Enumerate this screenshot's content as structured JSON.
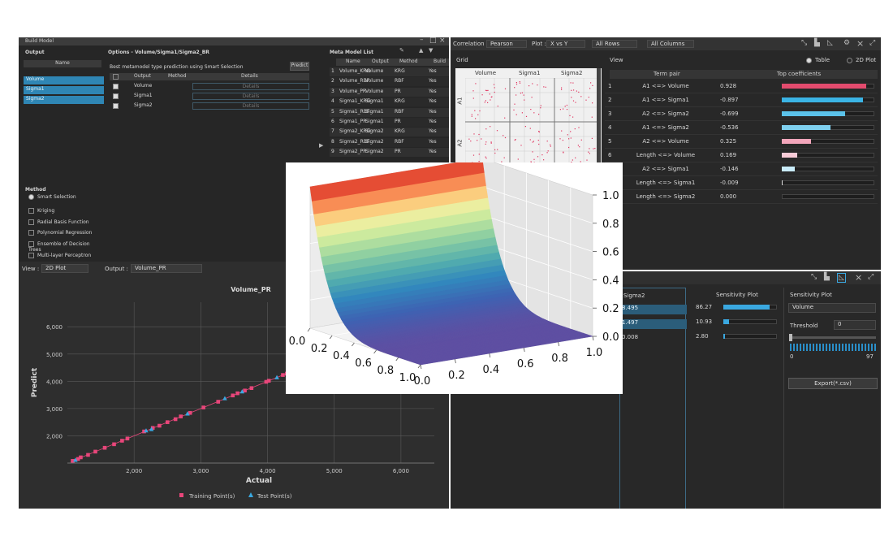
{
  "model_window": {
    "title": "Build Model",
    "output_panel": {
      "header": "Output",
      "col_name": "Name",
      "items": [
        "Volume",
        "Sigma1",
        "Sigma2"
      ]
    },
    "options_panel": {
      "header": "Options - Volume/Sigma1/Sigma2_BR",
      "hint": "Best metamodel type prediction using Smart Selection",
      "predict_label": "Predict",
      "cols": [
        "Output",
        "Method",
        "Details"
      ],
      "rows": [
        {
          "output": "Volume",
          "method": "",
          "details": "Details"
        },
        {
          "output": "Sigma1",
          "method": "",
          "details": "Details"
        },
        {
          "output": "Sigma2",
          "method": "",
          "details": "Details"
        }
      ]
    },
    "method_panel": {
      "header": "Method",
      "options": [
        "Smart Selection",
        "Kriging",
        "Radial Basis Function",
        "Polynomial Regression",
        "Ensemble of Decision Trees",
        "Multi-layer Perceptron"
      ]
    },
    "meta_list": {
      "header": "Meta Model List",
      "cols": [
        "Name",
        "Output",
        "Method",
        "Build"
      ],
      "rows": [
        [
          "1",
          "Volume_KRG",
          "Volume",
          "KRG",
          "Yes"
        ],
        [
          "2",
          "Volume_RBF",
          "Volume",
          "RBF",
          "Yes"
        ],
        [
          "3",
          "Volume_PR",
          "Volume",
          "PR",
          "Yes"
        ],
        [
          "4",
          "Sigma1_KRG",
          "Sigma1",
          "KRG",
          "Yes"
        ],
        [
          "5",
          "Sigma1_RBF",
          "Sigma1",
          "RBF",
          "Yes"
        ],
        [
          "6",
          "Sigma1_PR",
          "Sigma1",
          "PR",
          "Yes"
        ],
        [
          "7",
          "Sigma2_KRG",
          "Sigma2",
          "KRG",
          "Yes"
        ],
        [
          "8",
          "Sigma2_RBF",
          "Sigma2",
          "RBF",
          "Yes"
        ],
        [
          "9",
          "Sigma2_PR",
          "Sigma2",
          "PR",
          "Yes"
        ]
      ]
    }
  },
  "correlation_window": {
    "toolbar": {
      "correlation_label": "Correlation :",
      "correlation_value": "Pearson",
      "plot_label": "Plot :",
      "plot_value": "X vs Y",
      "rows_value": "All Rows",
      "columns_value": "All Columns"
    },
    "grid_label": "Grid",
    "grid_cols": [
      "Volume",
      "Sigma1",
      "Sigma2"
    ],
    "grid_rows": [
      "A1",
      "A2"
    ],
    "view_label": "View",
    "view_table": "Table",
    "view_2d": "2D Plot",
    "table_cols": [
      "Term pair",
      "Top coefficients"
    ],
    "table_rows": [
      {
        "idx": "1",
        "pair": "A1 <=> Volume",
        "coef": 0.928,
        "color": "#e34b6e"
      },
      {
        "idx": "2",
        "pair": "A1 <=> Sigma1",
        "coef": -0.897,
        "color": "#3bb4e5"
      },
      {
        "idx": "3",
        "pair": "A2 <=> Sigma2",
        "coef": -0.699,
        "color": "#5bc2ea"
      },
      {
        "idx": "4",
        "pair": "A1 <=> Sigma2",
        "coef": -0.536,
        "color": "#7fd0ef"
      },
      {
        "idx": "5",
        "pair": "A2 <=> Volume",
        "coef": 0.325,
        "color": "#f3a6bb"
      },
      {
        "idx": "6",
        "pair": "Length <=> Volume",
        "coef": 0.169,
        "color": "#f8cbd7"
      },
      {
        "idx": "7",
        "pair": "A2 <=> Sigma1",
        "coef": -0.146,
        "color": "#c9ecfa"
      },
      {
        "idx": "8",
        "pair": "Length <=> Sigma1",
        "coef": -0.009,
        "color": "#dddddd"
      },
      {
        "idx": "9",
        "pair": "Length <=> Sigma2",
        "coef": 0.0,
        "color": "#dddddd"
      }
    ],
    "table_coef_text": [
      "0.928",
      "-0.897",
      "-0.699",
      "-0.536",
      "0.325",
      "0.169",
      "-0.146",
      "-0.009",
      "0.000"
    ]
  },
  "sensitivity_window": {
    "col_sigma2": "Sigma2",
    "sigma2_values": [
      "8.495",
      "1.497",
      "0.008"
    ],
    "col_plot": "Sensitivity Plot",
    "plot_values": [
      86.27,
      10.93,
      2.8
    ],
    "plot_text": [
      "86.27",
      "10.93",
      "2.80"
    ],
    "side_header": "Sensitivity Plot",
    "side_output": "Volume",
    "threshold_label": "Threshold",
    "threshold_value": "0",
    "slider_min": "0",
    "slider_max": "97",
    "export_label": "Export(*.csv)"
  },
  "prediction_window": {
    "view_label": "View :",
    "view_value": "2D Plot",
    "output_label": "Output :",
    "output_value": "Volume_PR",
    "chart_title": "Volume_PR",
    "legend_train": "Training Point(s)",
    "legend_test": "Test Point(s)",
    "colors": {
      "train": "#e8467a",
      "test": "#3aa8e0"
    }
  },
  "chart_data": [
    {
      "type": "scatter",
      "title": "Volume_PR",
      "xlabel": "Actual",
      "ylabel": "Predict",
      "xlim": [
        1000,
        6500
      ],
      "ylim": [
        1000,
        6900
      ],
      "xticks": [
        2000,
        3000,
        4000,
        5000,
        6000
      ],
      "yticks": [
        2000,
        3000,
        4000,
        5000,
        6000
      ],
      "xtick_labels": [
        "2,000",
        "3,000",
        "4,000",
        "5,000",
        "6,000"
      ],
      "ytick_labels": [
        "2,000",
        "3,000",
        "4,000",
        "5,000",
        "6,000"
      ],
      "grid": true,
      "legend": "bottom-center",
      "series": [
        {
          "name": "Training Point(s)",
          "marker": "square",
          "x": [
            1080,
            1160,
            1200,
            1310,
            1420,
            1560,
            1700,
            1820,
            1900,
            2150,
            2280,
            2380,
            2500,
            2620,
            2700,
            2840,
            3040,
            3260,
            3480,
            3550,
            3660,
            3760,
            3980,
            4020,
            4230,
            4290,
            4350
          ],
          "y": [
            1080,
            1150,
            1210,
            1300,
            1420,
            1560,
            1690,
            1820,
            1900,
            2160,
            2290,
            2370,
            2500,
            2610,
            2710,
            2840,
            3040,
            3250,
            3480,
            3560,
            3660,
            3750,
            3980,
            4020,
            4230,
            4280,
            4350
          ]
        },
        {
          "name": "Test Point(s)",
          "marker": "triangle",
          "x": [
            1120,
            2180,
            2260,
            2800,
            3360,
            3620,
            4140
          ],
          "y": [
            1110,
            2190,
            2240,
            2810,
            3370,
            3620,
            4140
          ]
        }
      ]
    },
    {
      "type": "surface",
      "xticks": [
        0.0,
        0.2,
        0.4,
        0.6,
        0.8,
        1.0
      ],
      "yticks": [
        0.0,
        0.2,
        0.4,
        0.6,
        0.8,
        1.0
      ],
      "zticks": [
        0.0,
        0.2,
        0.4,
        0.6,
        0.8,
        1.0
      ],
      "xtick_labels": [
        "0.0",
        "0.2",
        "0.4",
        "0.6",
        "0.8",
        "1.0"
      ],
      "ytick_labels": [
        "0.0",
        "0.2",
        "0.4",
        "0.6",
        "0.8",
        "1.0"
      ],
      "ztick_labels": [
        "0.0",
        "0.2",
        "0.4",
        "0.6",
        "0.8",
        "1.0"
      ],
      "xlim": [
        0,
        1
      ],
      "ylim": [
        0,
        1
      ],
      "zlim": [
        0,
        1
      ],
      "colormap": "rainbow",
      "surface_profile": {
        "x": [
          0.0,
          0.5,
          0.7,
          0.8,
          0.9,
          1.0
        ],
        "z": [
          0.0,
          0.03,
          0.12,
          0.26,
          0.52,
          1.0
        ]
      }
    }
  ]
}
